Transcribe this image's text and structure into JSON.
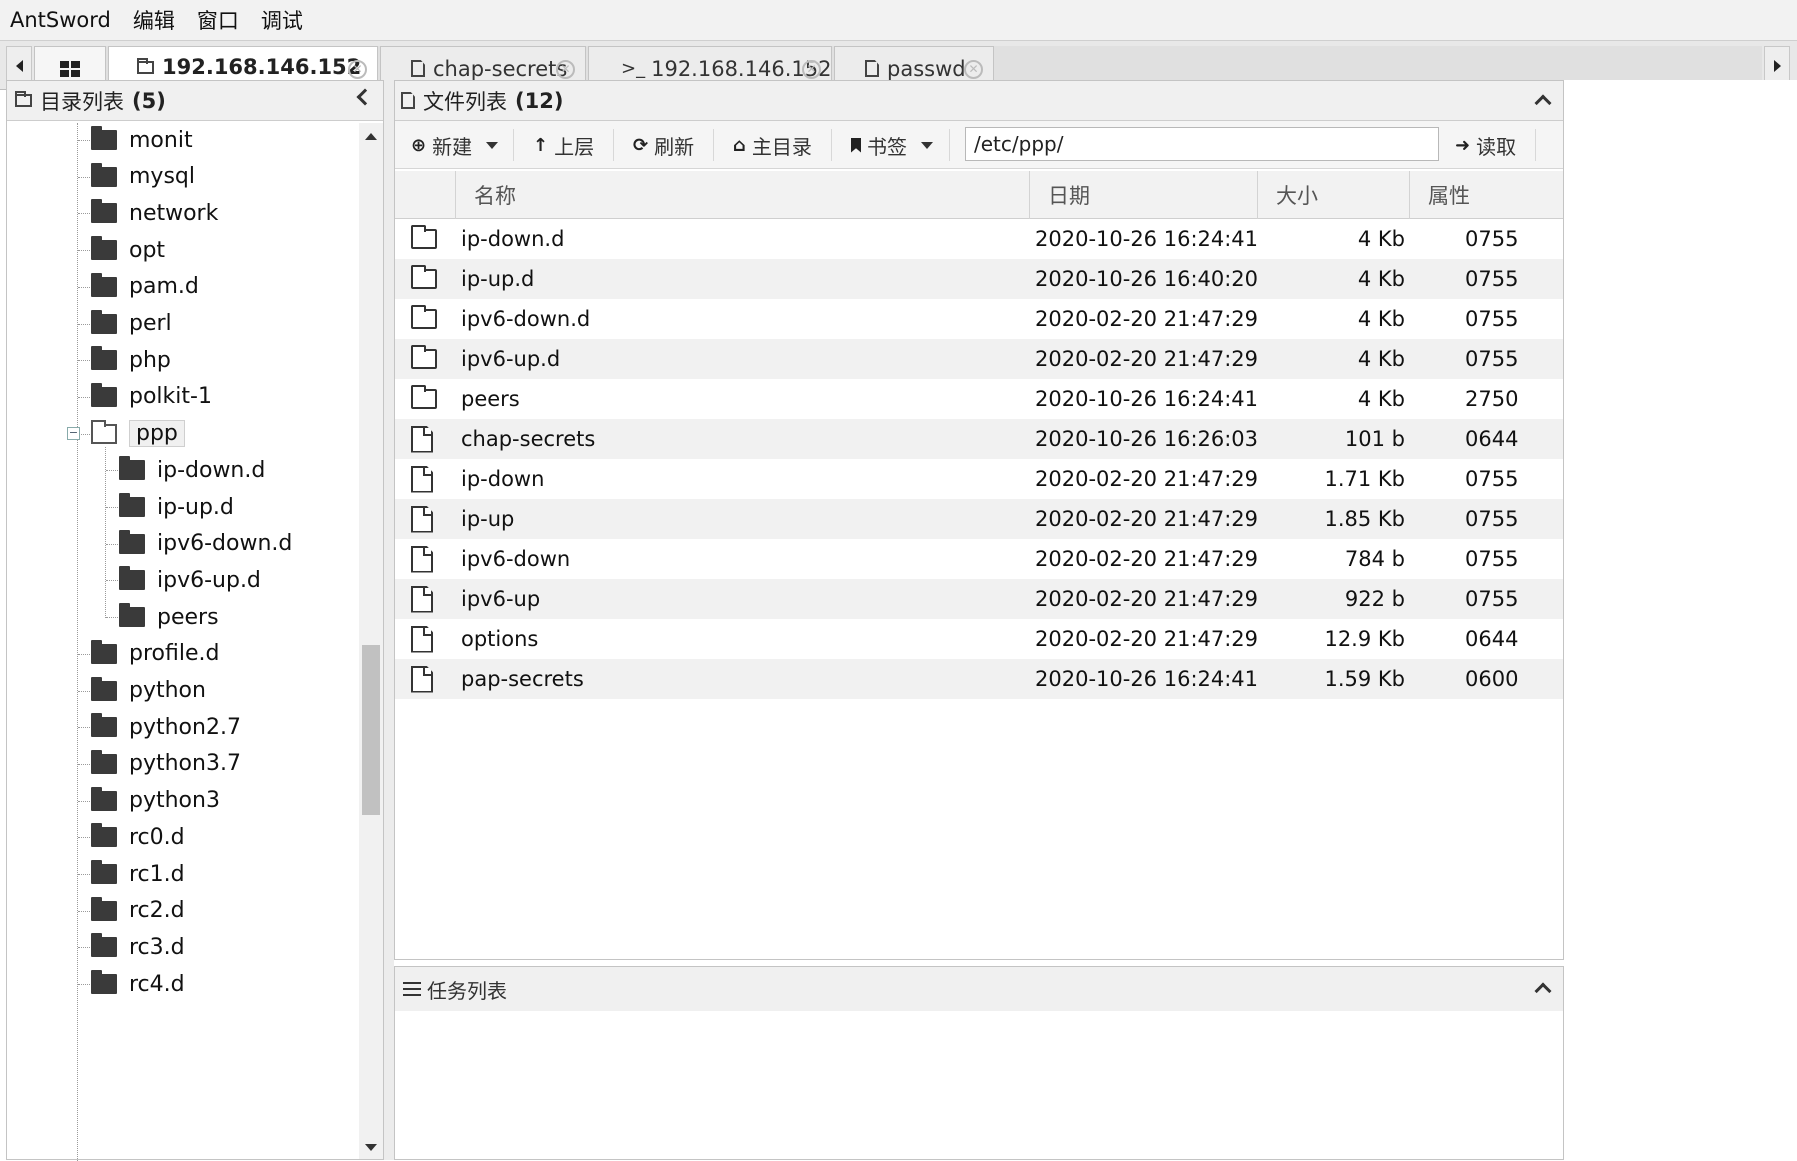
{
  "menubar": {
    "items": [
      "AntSword",
      "编辑",
      "窗口",
      "调试"
    ]
  },
  "tabs": {
    "dir": "192.168.146.152",
    "chap": "chap-secrets",
    "term": "192.168.146.152",
    "term_prefix": ">_",
    "passwd": "passwd"
  },
  "left": {
    "title": "目录列表",
    "count": "(5)",
    "tree": [
      {
        "name": "monit",
        "level": 0
      },
      {
        "name": "mysql",
        "level": 0
      },
      {
        "name": "network",
        "level": 0
      },
      {
        "name": "opt",
        "level": 0
      },
      {
        "name": "pam.d",
        "level": 0
      },
      {
        "name": "perl",
        "level": 0
      },
      {
        "name": "php",
        "level": 0
      },
      {
        "name": "polkit-1",
        "level": 0
      },
      {
        "name": "ppp",
        "level": 0,
        "open": true,
        "selected": true
      },
      {
        "name": "ip-down.d",
        "level": 1
      },
      {
        "name": "ip-up.d",
        "level": 1
      },
      {
        "name": "ipv6-down.d",
        "level": 1
      },
      {
        "name": "ipv6-up.d",
        "level": 1
      },
      {
        "name": "peers",
        "level": 1
      },
      {
        "name": "profile.d",
        "level": 0
      },
      {
        "name": "python",
        "level": 0
      },
      {
        "name": "python2.7",
        "level": 0
      },
      {
        "name": "python3.7",
        "level": 0
      },
      {
        "name": "python3",
        "level": 0
      },
      {
        "name": "rc0.d",
        "level": 0
      },
      {
        "name": "rc1.d",
        "level": 0
      },
      {
        "name": "rc2.d",
        "level": 0
      },
      {
        "name": "rc3.d",
        "level": 0
      },
      {
        "name": "rc4.d",
        "level": 0
      }
    ]
  },
  "right": {
    "title": "文件列表",
    "count": "(12)",
    "toolbar": {
      "new": "新建",
      "up": "上层",
      "refresh": "刷新",
      "home": "主目录",
      "bookmark": "书签",
      "path": "/etc/ppp/",
      "read": "读取"
    },
    "columns": {
      "name": "名称",
      "date": "日期",
      "size": "大小",
      "attr": "属性"
    },
    "files": [
      {
        "type": "folder",
        "name": "ip-down.d",
        "date": "2020-10-26 16:24:41",
        "size": "4 Kb",
        "attr": "0755"
      },
      {
        "type": "folder",
        "name": "ip-up.d",
        "date": "2020-10-26 16:40:20",
        "size": "4 Kb",
        "attr": "0755"
      },
      {
        "type": "folder",
        "name": "ipv6-down.d",
        "date": "2020-02-20 21:47:29",
        "size": "4 Kb",
        "attr": "0755"
      },
      {
        "type": "folder",
        "name": "ipv6-up.d",
        "date": "2020-02-20 21:47:29",
        "size": "4 Kb",
        "attr": "0755"
      },
      {
        "type": "folder",
        "name": "peers",
        "date": "2020-10-26 16:24:41",
        "size": "4 Kb",
        "attr": "2750"
      },
      {
        "type": "file",
        "name": "chap-secrets",
        "date": "2020-10-26 16:26:03",
        "size": "101 b",
        "attr": "0644"
      },
      {
        "type": "file",
        "name": "ip-down",
        "date": "2020-02-20 21:47:29",
        "size": "1.71 Kb",
        "attr": "0755"
      },
      {
        "type": "file",
        "name": "ip-up",
        "date": "2020-02-20 21:47:29",
        "size": "1.85 Kb",
        "attr": "0755"
      },
      {
        "type": "file",
        "name": "ipv6-down",
        "date": "2020-02-20 21:47:29",
        "size": "784 b",
        "attr": "0755"
      },
      {
        "type": "file",
        "name": "ipv6-up",
        "date": "2020-02-20 21:47:29",
        "size": "922 b",
        "attr": "0755"
      },
      {
        "type": "file",
        "name": "options",
        "date": "2020-02-20 21:47:29",
        "size": "12.9 Kb",
        "attr": "0644"
      },
      {
        "type": "file",
        "name": "pap-secrets",
        "date": "2020-10-26 16:24:41",
        "size": "1.59 Kb",
        "attr": "0600"
      }
    ]
  },
  "task": {
    "title": "任务列表"
  }
}
